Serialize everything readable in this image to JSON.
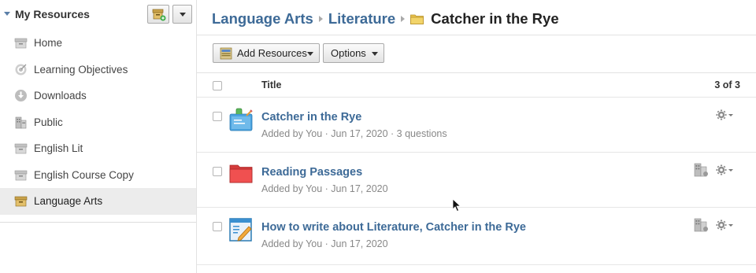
{
  "sidebar": {
    "title": "My Resources",
    "items": [
      {
        "label": "Home",
        "icon": "archive-box-icon"
      },
      {
        "label": "Learning Objectives",
        "icon": "target-icon"
      },
      {
        "label": "Downloads",
        "icon": "download-icon"
      },
      {
        "label": "Public",
        "icon": "buildings-icon"
      },
      {
        "label": "English Lit",
        "icon": "archive-box-icon"
      },
      {
        "label": "English Course Copy",
        "icon": "archive-box-icon"
      },
      {
        "label": "Language Arts",
        "icon": "archive-box-icon",
        "active": true
      }
    ]
  },
  "breadcrumb": {
    "items": [
      "Language Arts",
      "Literature"
    ],
    "current": "Catcher in the Rye"
  },
  "toolbar": {
    "add_label": "Add Resources",
    "options_label": "Options"
  },
  "table": {
    "title_header": "Title",
    "count": "3 of 3",
    "rows": [
      {
        "title": "Catcher in the Rye",
        "meta": "Added by You · Jun 17, 2020 · 3 questions",
        "icon": "quiz-icon",
        "shared": false
      },
      {
        "title": "Reading Passages",
        "meta": "Added by You · Jun 17, 2020",
        "icon": "folder-icon",
        "shared": true
      },
      {
        "title": "How to write about Literature, Catcher in the Rye",
        "meta": "Added by You · Jun 17, 2020",
        "icon": "document-edit-icon",
        "shared": true
      }
    ]
  },
  "colors": {
    "link": "#3d6a97",
    "active_bg": "#ececec",
    "folder_red": "#e84b4b",
    "folder_yellow": "#e9c34d"
  }
}
